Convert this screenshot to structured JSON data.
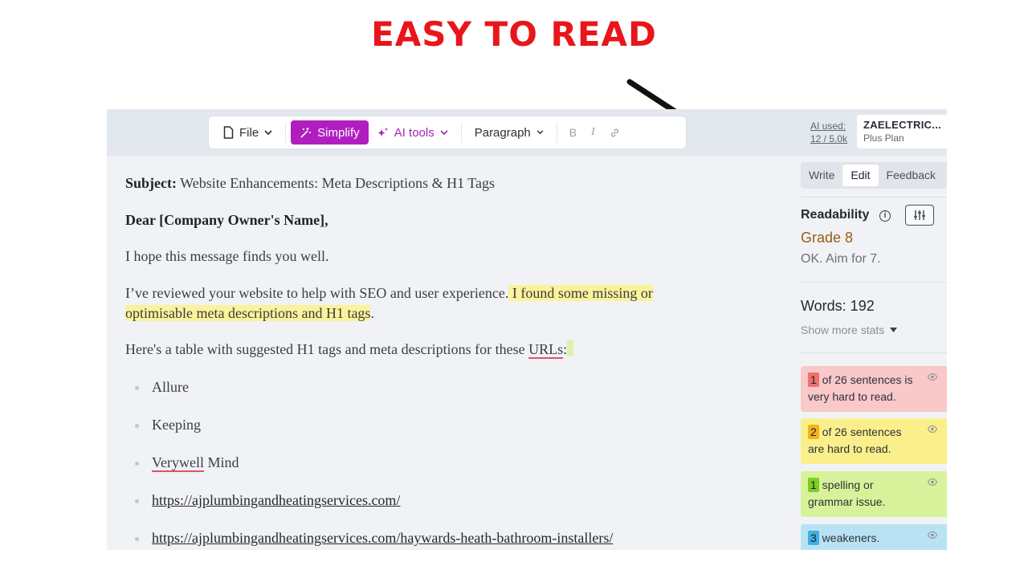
{
  "headline": "EASY TO READ",
  "toolbar": {
    "file_label": "File",
    "simplify_label": "Simplify",
    "ai_tools_label": "AI tools",
    "paragraph_label": "Paragraph",
    "bold_label": "B",
    "italic_label": "I"
  },
  "ai_usage": {
    "label": "AI used:",
    "value": "12 / 5.0k"
  },
  "account": {
    "name": "ZAELECTRIC...",
    "plan": "Plus Plan"
  },
  "mode_tabs": [
    "Write",
    "Edit",
    "Feedback"
  ],
  "document": {
    "subject_label": "Subject:",
    "subject_text": " Website Enhancements: Meta Descriptions & H1 Tags",
    "greeting": "Dear [Company Owner's Name],",
    "p1": "I hope this message finds you well.",
    "p2_plain": "I’ve reviewed your website to help with SEO and user experience.",
    "p2_hl_a": " I found some missing or",
    "p2_hl_b": "optimisable meta descriptions and H1 tags",
    "p2_end": ".",
    "p3_plain": "Here's a table with suggested H1 tags and meta descriptions for these ",
    "p3_word": "URLs",
    "p3_end": ":",
    "bullets": [
      "Allure",
      "Keeping",
      "Verywell",
      "Mind",
      "https://ajplumbingandheatingservices.com/",
      "https://ajplumbingandheatingservices.com/haywards-heath-bathroom-installers/"
    ]
  },
  "readability": {
    "title": "Readability",
    "grade": "Grade 8",
    "note": "OK. Aim for 7.",
    "words": "Words: 192",
    "more_stats": "Show more stats"
  },
  "cards": [
    {
      "num": "1",
      "line1": " of 26 sentences is",
      "line2": "very hard to read.",
      "bg": "#f9c8c8",
      "badge": "#f06f6f"
    },
    {
      "num": "2",
      "line1": " of 26 sentences",
      "line2": "are hard to read.",
      "bg": "#fbef8c",
      "badge": "#f4b31c"
    },
    {
      "num": "1",
      "line1": " spelling or",
      "line2": "grammar issue.",
      "bg": "#d7f29a",
      "badge": "#7ccf22"
    },
    {
      "num": "3",
      "line1": " weakeners.",
      "line2": "",
      "bg": "#b9e3f5",
      "badge": "#3fb0e3"
    }
  ]
}
